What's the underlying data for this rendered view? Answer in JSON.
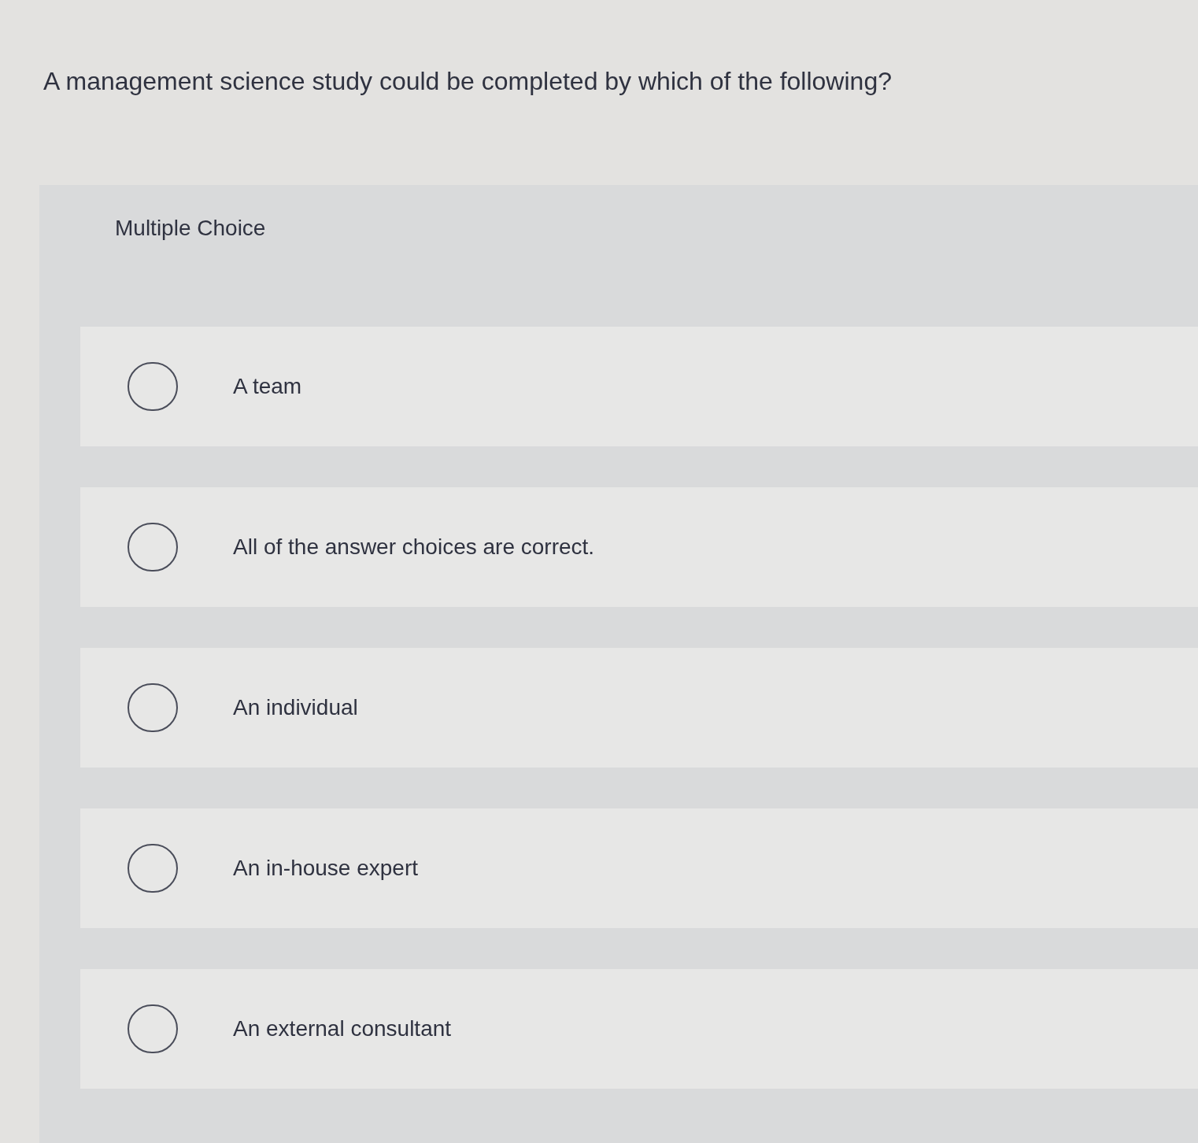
{
  "question": {
    "text": "A management science study could be completed by which of the following?"
  },
  "answer_panel": {
    "heading": "Multiple Choice",
    "options": [
      {
        "label": "A team",
        "selected": false
      },
      {
        "label": "All of the answer choices are correct.",
        "selected": false
      },
      {
        "label": "An individual",
        "selected": false
      },
      {
        "label": "An in-house expert",
        "selected": false
      },
      {
        "label": "An external consultant",
        "selected": false
      }
    ]
  }
}
